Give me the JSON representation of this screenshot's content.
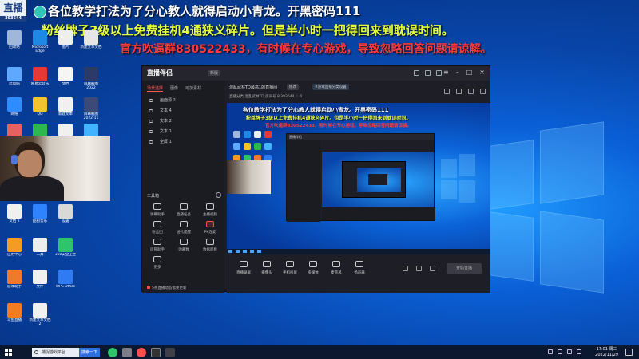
{
  "overlay": {
    "line1": "各位教学打法为了分心教人就得启动小青龙。开黑密码111",
    "line2": "粉丝牌子3级以上免费挂机4通狭义碎片。但是半小时一把得回来到耽误时间。",
    "line3": "官方吹逼群830522433，有时候在专心游戏，导致忽略回答问题请谅解。"
  },
  "watermark": {
    "text": "直播",
    "sub": "393644"
  },
  "desktop_icons": [
    {
      "label": "回收站",
      "color": "#9fb7d9"
    },
    {
      "label": "Microsoft Edge",
      "color": "#1e88e5"
    },
    {
      "label": "图片",
      "color": "#eeeeee"
    },
    {
      "label": "新建文本文档",
      "color": "#e6e6e6"
    },
    {
      "label": "此电脑",
      "color": "#5fa8ff"
    },
    {
      "label": "网易云音乐",
      "color": "#e53935"
    },
    {
      "label": "文档",
      "color": "#f5f5f5"
    },
    {
      "label": "屏幕截图 2022",
      "color": "#2b3a66"
    },
    {
      "label": "网络",
      "color": "#2f8cff"
    },
    {
      "label": "QQ",
      "color": "#f4c430"
    },
    {
      "label": "新建文本",
      "color": "#f0f0f0"
    },
    {
      "label": "屏幕截图 2022-11",
      "color": "#3b4a78"
    },
    {
      "label": "控制面板",
      "color": "#e96060"
    },
    {
      "label": "微信",
      "color": "#2db84d"
    },
    {
      "label": "游戏",
      "color": "#f0f0f0"
    },
    {
      "label": "腾讯QQ",
      "color": "#41b3ff"
    },
    {
      "label": "文档 2",
      "color": "#f0f0f0"
    },
    {
      "label": "酷狗音乐",
      "color": "#2f83ff"
    },
    {
      "label": "设置",
      "color": "#d9d9d9"
    },
    {
      "label": "应用中心",
      "color": "#f59a23"
    },
    {
      "label": "工具",
      "color": "#eeeeee"
    },
    {
      "label": "360安全卫士",
      "color": "#2ec46b"
    },
    {
      "label": "游戏助手",
      "color": "#f07a2a"
    },
    {
      "label": "文件",
      "color": "#f0f0f0"
    },
    {
      "label": "WPS Office",
      "color": "#2e7bf3"
    },
    {
      "label": "斗鱼直播",
      "color": "#f47b20"
    },
    {
      "label": "新建文本文档 (2)",
      "color": "#f0f0f0"
    }
  ],
  "app": {
    "brand": "直播伴侣",
    "version": "新版",
    "left_tabs": [
      "场景选择",
      "图像",
      "可加素材"
    ],
    "scenes": [
      "画面源 2",
      "文本 4",
      "文本 2",
      "文本 1",
      "全屏 1"
    ],
    "tools_title": "工具箱",
    "tools": [
      {
        "label": "弹幕助手",
        "red": false
      },
      {
        "label": "直播任务",
        "red": false
      },
      {
        "label": "主播视频",
        "red": false
      },
      {
        "label": "粉丝团",
        "red": false
      },
      {
        "label": "送礼提醒",
        "red": false
      },
      {
        "label": "PK连麦",
        "red": true
      },
      {
        "label": "房管助手",
        "red": false
      },
      {
        "label": "弹幕数",
        "red": false
      },
      {
        "label": "数据面板",
        "red": false
      },
      {
        "label": "更多",
        "red": false
      }
    ],
    "footer": "5条直播动态需要更新",
    "room_title": "混乱武林TD最高1的直播间",
    "room_tag1": "修改",
    "room_tag2": "#游戏直播分类设置",
    "room_line2": "直播分类  混乱武林TD  房间号 8  393644  ♡ 0",
    "preview_overlay": {
      "l1": "各位教学打法为了分心教人就得启动小青龙。开黑密码111",
      "l2": "粉丝牌子3级以上免费挂机4通狭义碎片。但是半小时一把得回来到耽误时间。",
      "l3": "官方吹逼群830522433，有时候在专心游戏，导致忽略回答问题请谅解。"
    },
    "controls": [
      {
        "label": "直播录屏"
      },
      {
        "label": "摄像头"
      },
      {
        "label": "手机投屏"
      },
      {
        "label": "多媒体"
      },
      {
        "label": "麦克风"
      },
      {
        "label": "扬声器"
      }
    ],
    "start_live": "开始直播"
  },
  "taskbar": {
    "search_placeholder": "捕捉游戏平台",
    "search_btn": "搜索一下",
    "time": "17:01 周二",
    "date": "2022/11/29"
  }
}
